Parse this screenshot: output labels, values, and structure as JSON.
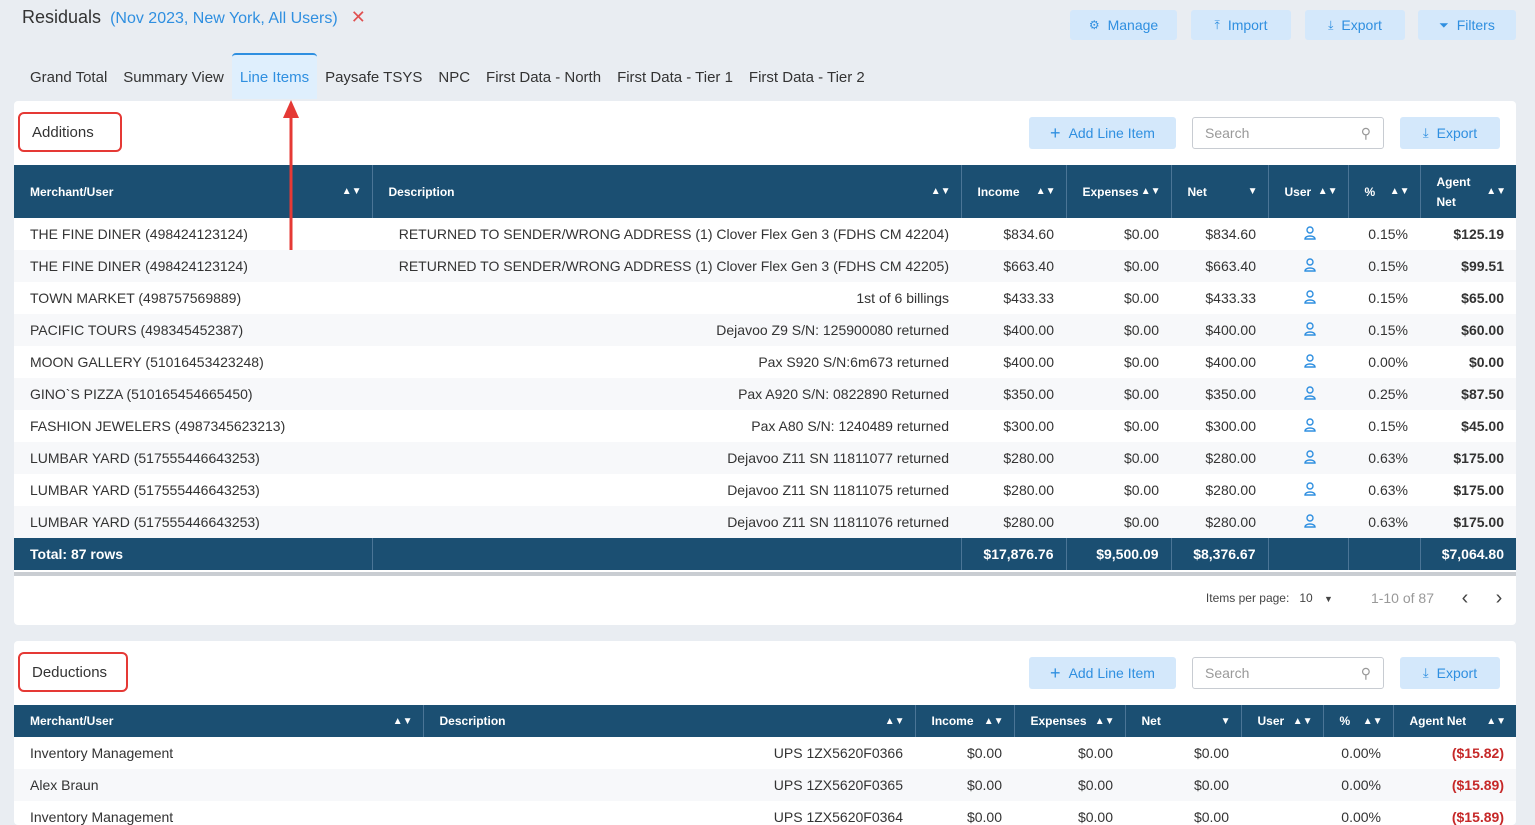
{
  "header": {
    "title": "Residuals",
    "subtitle": "(Nov 2023, New York, All Users)",
    "close_glyph": "✕",
    "buttons": [
      {
        "label": "Manage",
        "icon": "gear-icon"
      },
      {
        "label": "Import",
        "icon": "upload-icon"
      },
      {
        "label": "Export",
        "icon": "download-icon"
      },
      {
        "label": "Filters",
        "icon": "filter-icon"
      }
    ]
  },
  "tabs": [
    {
      "label": "Grand Total"
    },
    {
      "label": "Summary View"
    },
    {
      "label": "Line Items",
      "active": true
    },
    {
      "label": "Paysafe TSYS"
    },
    {
      "label": "NPC"
    },
    {
      "label": "First Data - North"
    },
    {
      "label": "First Data - Tier 1"
    },
    {
      "label": "First Data - Tier 2"
    }
  ],
  "additions": {
    "title": "Additions",
    "add_label": "Add Line Item",
    "search_placeholder": "Search",
    "export_label": "Export",
    "columns": [
      "Merchant/User",
      "Description",
      "Income",
      "Expenses",
      "Net",
      "User",
      "%",
      "Agent",
      "Net"
    ],
    "rows": [
      {
        "merchant": "THE FINE DINER (498424123124)",
        "description": "RETURNED TO SENDER/WRONG ADDRESS (1) Clover Flex Gen 3 (FDHS CM 42204)",
        "income": "$834.60",
        "expenses": "$0.00",
        "net": "$834.60",
        "pct": "0.15%",
        "agent_net": "$125.19"
      },
      {
        "merchant": "THE FINE DINER (498424123124)",
        "description": "RETURNED TO SENDER/WRONG ADDRESS (1) Clover Flex Gen 3 (FDHS CM 42205)",
        "income": "$663.40",
        "expenses": "$0.00",
        "net": "$663.40",
        "pct": "0.15%",
        "agent_net": "$99.51"
      },
      {
        "merchant": "TOWN MARKET (498757569889)",
        "description": "1st of 6 billings",
        "income": "$433.33",
        "expenses": "$0.00",
        "net": "$433.33",
        "pct": "0.15%",
        "agent_net": "$65.00"
      },
      {
        "merchant": "PACIFIC TOURS (498345452387)",
        "description": "Dejavoo Z9 S/N: 125900080 returned",
        "income": "$400.00",
        "expenses": "$0.00",
        "net": "$400.00",
        "pct": "0.15%",
        "agent_net": "$60.00"
      },
      {
        "merchant": "MOON GALLERY (51016453423248)",
        "description": "Pax S920 S/N:6m673 returned",
        "income": "$400.00",
        "expenses": "$0.00",
        "net": "$400.00",
        "pct": "0.00%",
        "agent_net": "$0.00"
      },
      {
        "merchant": "GINO`S PIZZA (510165454665450)",
        "description": "Pax A920 S/N: 0822890 Returned",
        "income": "$350.00",
        "expenses": "$0.00",
        "net": "$350.00",
        "pct": "0.25%",
        "agent_net": "$87.50"
      },
      {
        "merchant": "FASHION JEWELERS (4987345623213)",
        "description": "Pax A80 S/N: 1240489 returned",
        "income": "$300.00",
        "expenses": "$0.00",
        "net": "$300.00",
        "pct": "0.15%",
        "agent_net": "$45.00"
      },
      {
        "merchant": "LUMBAR YARD (517555446643253)",
        "description": "Dejavoo Z11 SN 11811077 returned",
        "income": "$280.00",
        "expenses": "$0.00",
        "net": "$280.00",
        "pct": "0.63%",
        "agent_net": "$175.00"
      },
      {
        "merchant": "LUMBAR YARD (517555446643253)",
        "description": "Dejavoo Z11 SN 11811075 returned",
        "income": "$280.00",
        "expenses": "$0.00",
        "net": "$280.00",
        "pct": "0.63%",
        "agent_net": "$175.00"
      },
      {
        "merchant": "LUMBAR YARD (517555446643253)",
        "description": "Dejavoo Z11 SN 11811076 returned",
        "income": "$280.00",
        "expenses": "$0.00",
        "net": "$280.00",
        "pct": "0.63%",
        "agent_net": "$175.00"
      }
    ],
    "total": {
      "label": "Total: 87 rows",
      "income": "$17,876.76",
      "expenses": "$9,500.09",
      "net": "$8,376.67",
      "agent_net": "$7,064.80"
    },
    "pager": {
      "items_label": "Items per page:",
      "per_page": "10",
      "range": "1-10 of 87"
    }
  },
  "deductions": {
    "title": "Deductions",
    "add_label": "Add Line Item",
    "search_placeholder": "Search",
    "export_label": "Export",
    "columns": [
      "Merchant/User",
      "Description",
      "Income",
      "Expenses",
      "Net",
      "User",
      "%",
      "Agent Net"
    ],
    "rows": [
      {
        "merchant": "Inventory Management",
        "description": "UPS 1ZX5620F0366",
        "income": "$0.00",
        "expenses": "$0.00",
        "net": "$0.00",
        "pct": "0.00%",
        "agent_net": "($15.82)"
      },
      {
        "merchant": "Alex Braun",
        "description": "UPS 1ZX5620F0365",
        "income": "$0.00",
        "expenses": "$0.00",
        "net": "$0.00",
        "pct": "0.00%",
        "agent_net": "($15.89)"
      },
      {
        "merchant": "Inventory Management",
        "description": "UPS 1ZX5620F0364",
        "income": "$0.00",
        "expenses": "$0.00",
        "net": "$0.00",
        "pct": "0.00%",
        "agent_net": "($15.89)"
      }
    ]
  },
  "colors": {
    "accent": "#2f8fe0",
    "header_bg": "#1b4f72",
    "highlight": "#e53935"
  }
}
